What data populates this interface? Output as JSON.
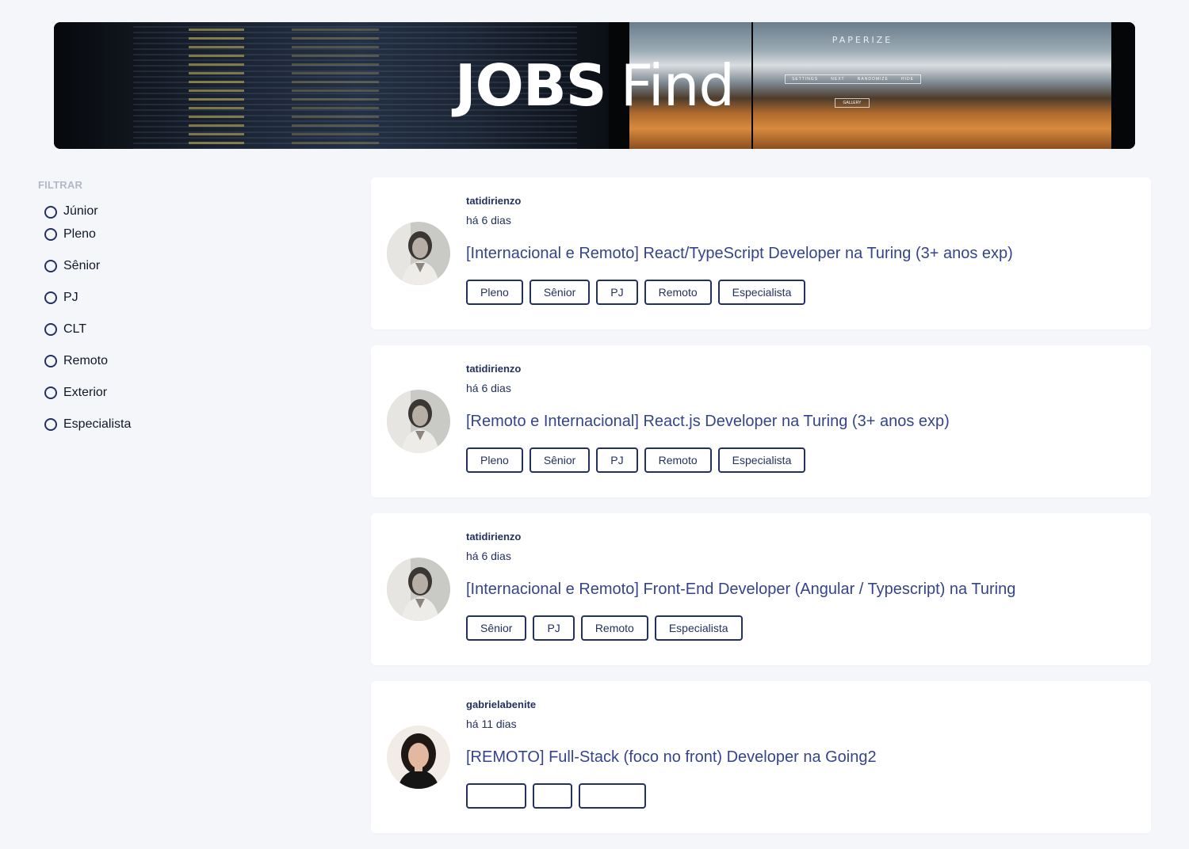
{
  "header": {
    "title_bold": "JOBS",
    "title_light": "Find",
    "banner_screen_text": "PAPERIZE",
    "banner_menu": [
      "SETTINGS",
      "NEXT",
      "RANDOMIZE",
      "HIDE"
    ],
    "banner_gallery": "GALLERY"
  },
  "filter": {
    "title": "FILTRAR",
    "options": [
      "Júnior",
      "Pleno",
      "Sênior",
      "PJ",
      "CLT",
      "Remoto",
      "Exterior",
      "Especialista"
    ]
  },
  "jobs": [
    {
      "author": "tatidirienzo",
      "date": "há 6 dias",
      "title": "[Internacional e Remoto] React/TypeScript Developer na Turing (3+ anos exp)",
      "tags": [
        "Pleno",
        "Sênior",
        "PJ",
        "Remoto",
        "Especialista"
      ],
      "avatar": "avatar-woman-bw"
    },
    {
      "author": "tatidirienzo",
      "date": "há 6 dias",
      "title": "[Remoto e Internacional] React.js Developer na Turing (3+ anos exp)",
      "tags": [
        "Pleno",
        "Sênior",
        "PJ",
        "Remoto",
        "Especialista"
      ],
      "avatar": "avatar-woman-bw"
    },
    {
      "author": "tatidirienzo",
      "date": "há 6 dias",
      "title": "[Internacional e Remoto] Front-End Developer (Angular / Typescript) na Turing",
      "tags": [
        "Sênior",
        "PJ",
        "Remoto",
        "Especialista"
      ],
      "avatar": "avatar-woman-bw"
    },
    {
      "author": "gabrielabenite",
      "date": "há 11 dias",
      "title": "[REMOTO] Full-Stack (foco no front) Developer na Going2",
      "tags": [
        "",
        "",
        ""
      ],
      "avatar": "avatar-woman-color"
    }
  ],
  "colors": {
    "background": "#f5f6fa",
    "card": "#ffffff",
    "primary": "#24315e",
    "title_link": "#34458a",
    "filter_title": "#b3b8c7"
  }
}
